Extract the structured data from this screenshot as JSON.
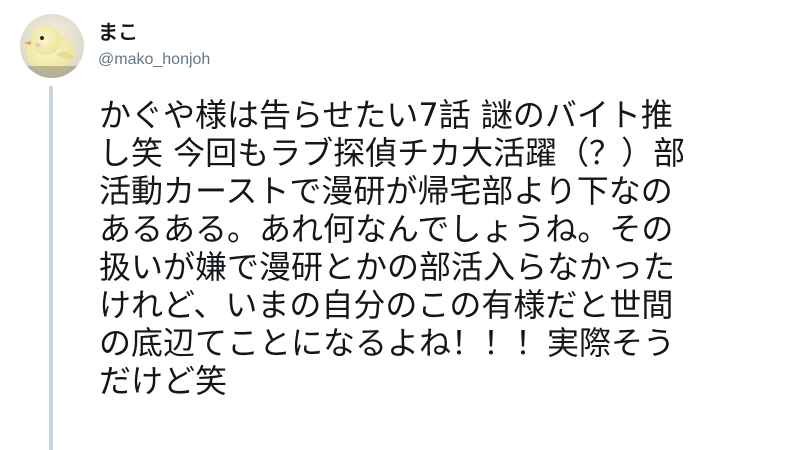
{
  "tweet": {
    "display_name": "まこ",
    "handle": "@mako_honjoh",
    "avatar_icon": "chick-avatar-icon",
    "text_lines": [
      "かぐや様は告らせたい7話 謎のバイト推",
      "し笑 今回もラブ探偵チカ大活躍（？）部",
      "活動カーストで漫研が帰宅部より下なの",
      "あるある。あれ何なんでしょうね。その",
      "扱いが嫌で漫研とかの部活入らなかった",
      "けれど、いまの自分のこの有様だと世間",
      "の底辺てことになるよね！！！実際そう",
      "だけど笑"
    ]
  },
  "colors": {
    "text": "#14171a",
    "secondary_text": "#657786",
    "thread_line": "#c9d3dc",
    "background": "#ffffff"
  }
}
